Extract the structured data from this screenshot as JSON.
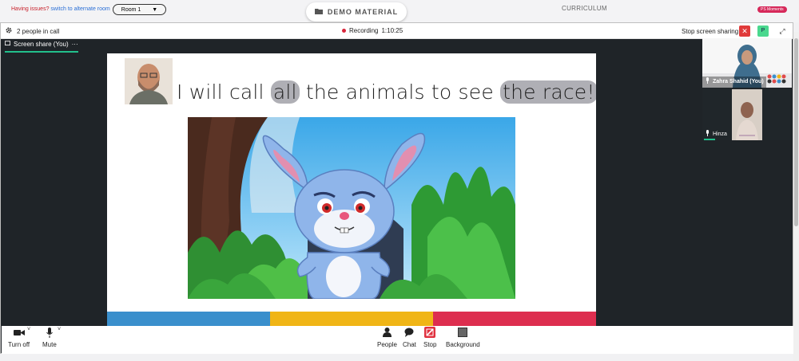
{
  "topbar": {
    "issues_label": "Having issues?",
    "alternate_link": "switch to alternate room",
    "room_value": "Room 1",
    "demo_label": "DEMO MATERIAL",
    "curriculum_label": "CURRICULUM",
    "badge_label": "PS Moments"
  },
  "call": {
    "people_count": "2 people in call",
    "recording_label": "Recording",
    "recording_time": "1:10:25",
    "stop_share_label": "Stop screen sharing",
    "p_button": "P",
    "share_tab_label": "Screen share (You)",
    "share_tab_menu": "···"
  },
  "slide": {
    "text_1": "I will call ",
    "text_hl1": "all",
    "text_2": " the animals to see ",
    "text_hl2": "the race!",
    "text_3": "\"",
    "bar_colors": [
      "#3a8fcc",
      "#f0b516",
      "#dd2e4f"
    ]
  },
  "participants": [
    {
      "name": "Zahra Shahid (You)"
    },
    {
      "name": "Hinza"
    }
  ],
  "toolbar": {
    "camera_label": "Turn off",
    "mic_label": "Mute",
    "people_label": "People",
    "chat_label": "Chat",
    "stop_label": "Stop",
    "background_label": "Background"
  },
  "colors": {
    "accent_green": "#22c08c",
    "record_red": "#d8253a"
  }
}
